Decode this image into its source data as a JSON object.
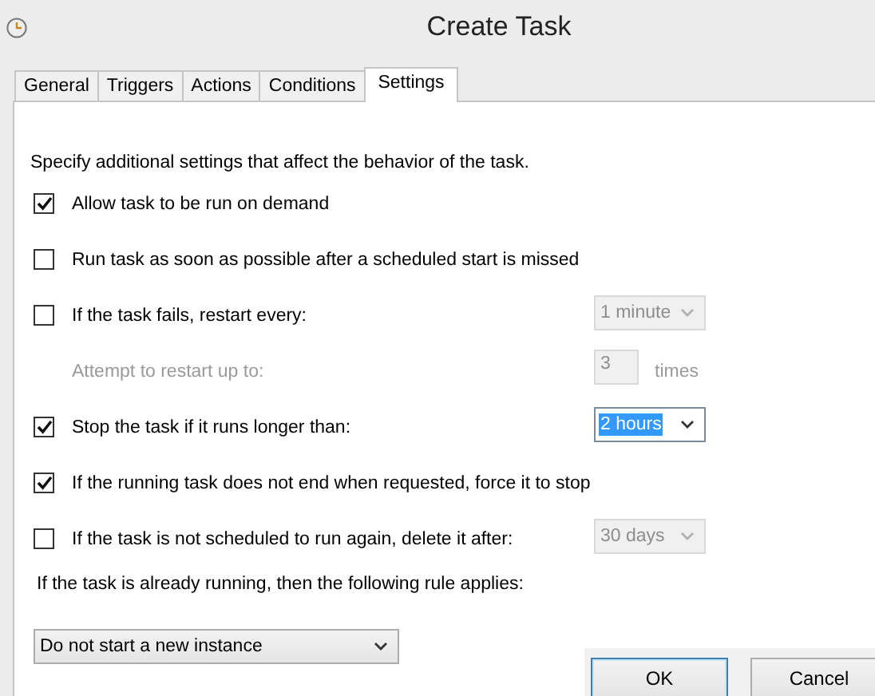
{
  "window": {
    "title": "Create Task"
  },
  "tabs": [
    {
      "label": "General",
      "selected": false
    },
    {
      "label": "Triggers",
      "selected": false
    },
    {
      "label": "Actions",
      "selected": false
    },
    {
      "label": "Conditions",
      "selected": false
    },
    {
      "label": "Settings",
      "selected": true
    }
  ],
  "settings": {
    "description": "Specify additional settings that affect the behavior of the task.",
    "options": [
      {
        "kind": "checkbox",
        "label": "Allow task to be run on demand",
        "checked": true
      },
      {
        "kind": "checkbox",
        "label": "Run task as soon as possible after a scheduled start is missed",
        "checked": false
      },
      {
        "kind": "checkbox",
        "label": "If the task fails, restart every:",
        "checked": false,
        "control": {
          "value": "1 minute",
          "disabled": true,
          "focused": false
        }
      },
      {
        "kind": "number",
        "label": "Attempt to restart up to:",
        "value": "3",
        "unit": "times",
        "disabled": true
      },
      {
        "kind": "checkbox",
        "label": "Stop the task if it runs longer than:",
        "checked": true,
        "control": {
          "value": "2 hours",
          "disabled": false,
          "focused": true
        }
      },
      {
        "kind": "checkbox",
        "label": "If the running task does not end when requested, force it to stop",
        "checked": true
      },
      {
        "kind": "checkbox",
        "label": "If the task is not scheduled to run again, delete it after:",
        "checked": false,
        "control": {
          "value": "30 days",
          "disabled": true,
          "focused": false
        }
      }
    ],
    "rule_label": "If the task is already running, then the following rule applies:",
    "rule_select": {
      "value": "Do not start a new instance",
      "disabled": false,
      "focused": false
    }
  },
  "buttons": [
    {
      "label": "OK",
      "default": true
    },
    {
      "label": "Cancel",
      "default": false
    }
  ]
}
